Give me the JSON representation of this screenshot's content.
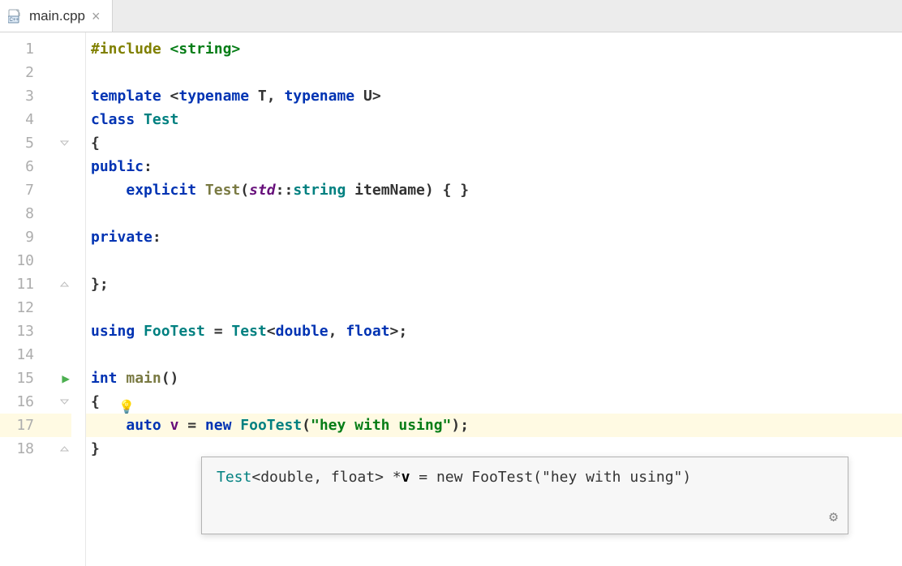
{
  "tab": {
    "filename": "main.cpp",
    "icon": "cpp-file-icon"
  },
  "lines": {
    "l1": {
      "num": "1"
    },
    "l2": {
      "num": "2"
    },
    "l3": {
      "num": "3"
    },
    "l4": {
      "num": "4"
    },
    "l5": {
      "num": "5"
    },
    "l6": {
      "num": "6"
    },
    "l7": {
      "num": "7"
    },
    "l8": {
      "num": "8"
    },
    "l9": {
      "num": "9"
    },
    "l10": {
      "num": "10"
    },
    "l11": {
      "num": "11"
    },
    "l12": {
      "num": "12"
    },
    "l13": {
      "num": "13"
    },
    "l14": {
      "num": "14"
    },
    "l15": {
      "num": "15"
    },
    "l16": {
      "num": "16"
    },
    "l17": {
      "num": "17"
    },
    "l18": {
      "num": "18"
    }
  },
  "code": {
    "l1": {
      "a": "#include ",
      "b": "<string>"
    },
    "l3": {
      "a": "template",
      "b": " <",
      "c": "typename",
      "d": " T, ",
      "e": "typename",
      "f": " U>"
    },
    "l4": {
      "a": "class",
      "b": " ",
      "c": "Test"
    },
    "l5": {
      "a": "{"
    },
    "l6": {
      "a": "public",
      "b": ":"
    },
    "l7": {
      "a": "    ",
      "b": "explicit",
      "c": " ",
      "d": "Test",
      "e": "(",
      "f": "std",
      "g": "::",
      "h": "string",
      "i": " itemName) { }"
    },
    "l9": {
      "a": "private",
      "b": ":"
    },
    "l11": {
      "a": "};"
    },
    "l13": {
      "a": "using",
      "b": " ",
      "c": "FooTest",
      "d": " = ",
      "e": "Test",
      "f": "<",
      "g": "double",
      "h": ", ",
      "i": "float",
      "j": ">;"
    },
    "l15": {
      "a": "int",
      "b": " ",
      "c": "main",
      "d": "()"
    },
    "l16": {
      "a": "{"
    },
    "l17": {
      "a": "    ",
      "b": "auto",
      "c": " ",
      "d": "v",
      "e": " = ",
      "f": "new",
      "g": " ",
      "h": "FooTest",
      "i": "(",
      "j": "\"hey with using\"",
      "k": ");"
    },
    "l18": {
      "a": "}"
    }
  },
  "tooltip": {
    "a": "Test",
    "b": "<double, float> *",
    "c": "v",
    "d": " = new FooTest(\"hey with using\")"
  },
  "icons": {
    "close": "×",
    "run": "▶",
    "bulb": "💡",
    "gear": "⚙"
  }
}
